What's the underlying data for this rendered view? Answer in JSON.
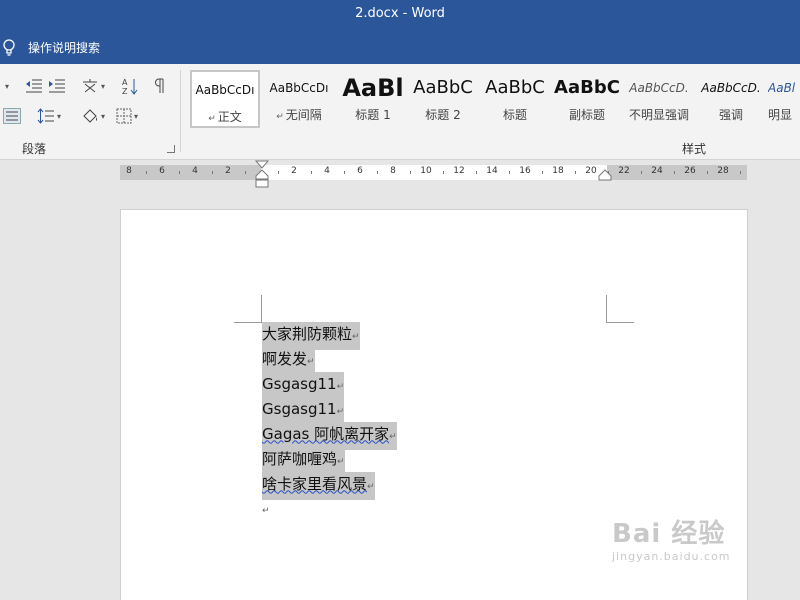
{
  "window": {
    "title": "2.docx  -  Word"
  },
  "search": {
    "label": "操作说明搜索"
  },
  "ribbon": {
    "paragraph_group_label": "段落",
    "styles_group_label": "样式",
    "styles": [
      {
        "preview": "AaBbCcDı",
        "name": "正文",
        "selected": true
      },
      {
        "preview": "AaBbCcDı",
        "name": "无间隔"
      },
      {
        "preview": "AaBl",
        "name": "标题 1"
      },
      {
        "preview": "AaBbC",
        "name": "标题 2"
      },
      {
        "preview": "AaBbC",
        "name": "标题"
      },
      {
        "preview": "AaBbC",
        "name": "副标题"
      },
      {
        "preview": "AaBbCcD.",
        "name": "不明显强调"
      },
      {
        "preview": "AaBbCcD.",
        "name": "强调"
      },
      {
        "preview": "AaBl",
        "name": "明显"
      }
    ],
    "return_mark": "↵"
  },
  "ruler": {
    "left_labels": [
      "8",
      "6",
      "4",
      "2"
    ],
    "right_labels": [
      "2",
      "4",
      "6",
      "8",
      "10",
      "12",
      "14",
      "16",
      "18",
      "20",
      "22",
      "24",
      "26",
      "28"
    ]
  },
  "document": {
    "pilcrow": "↵",
    "lines": [
      {
        "text": "大家荆防颗粒",
        "style": ""
      },
      {
        "text": "啊发发",
        "style": ""
      },
      {
        "text": "Gsgasg11",
        "style": ""
      },
      {
        "text": "Gsgasg11",
        "style": ""
      },
      {
        "text": "Gagas 阿帆离开家",
        "style": ""
      },
      {
        "text": "阿萨咖喱鸡",
        "style": ""
      },
      {
        "text": "啥卡家里看风景",
        "style": ""
      }
    ]
  },
  "watermark": {
    "main": "Bai 经验",
    "sub": "jingyan.baidu.com"
  }
}
